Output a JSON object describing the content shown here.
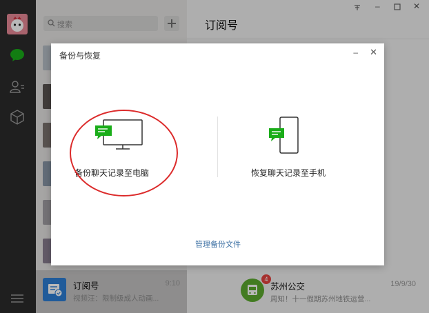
{
  "sidebar": {
    "search_placeholder": "搜索"
  },
  "chat_list": {
    "selected": {
      "name": "订阅号",
      "time": "9:10",
      "preview": "视频汪：限制级成人动画..."
    }
  },
  "content": {
    "title": "订阅号",
    "subscription_item": {
      "name": "苏州公交",
      "badge": "4",
      "date": "19/9/30",
      "preview": "周知！十一假期苏州地铁运营..."
    }
  },
  "dialog": {
    "title": "备份与恢复",
    "option_backup_label": "备份聊天记录至电脑",
    "option_restore_label": "恢复聊天记录至手机",
    "manage_link": "管理备份文件"
  },
  "colors": {
    "accent_green": "#1aad19",
    "link_blue": "#3b6fa3",
    "annotation_red": "#dc2b2b"
  }
}
